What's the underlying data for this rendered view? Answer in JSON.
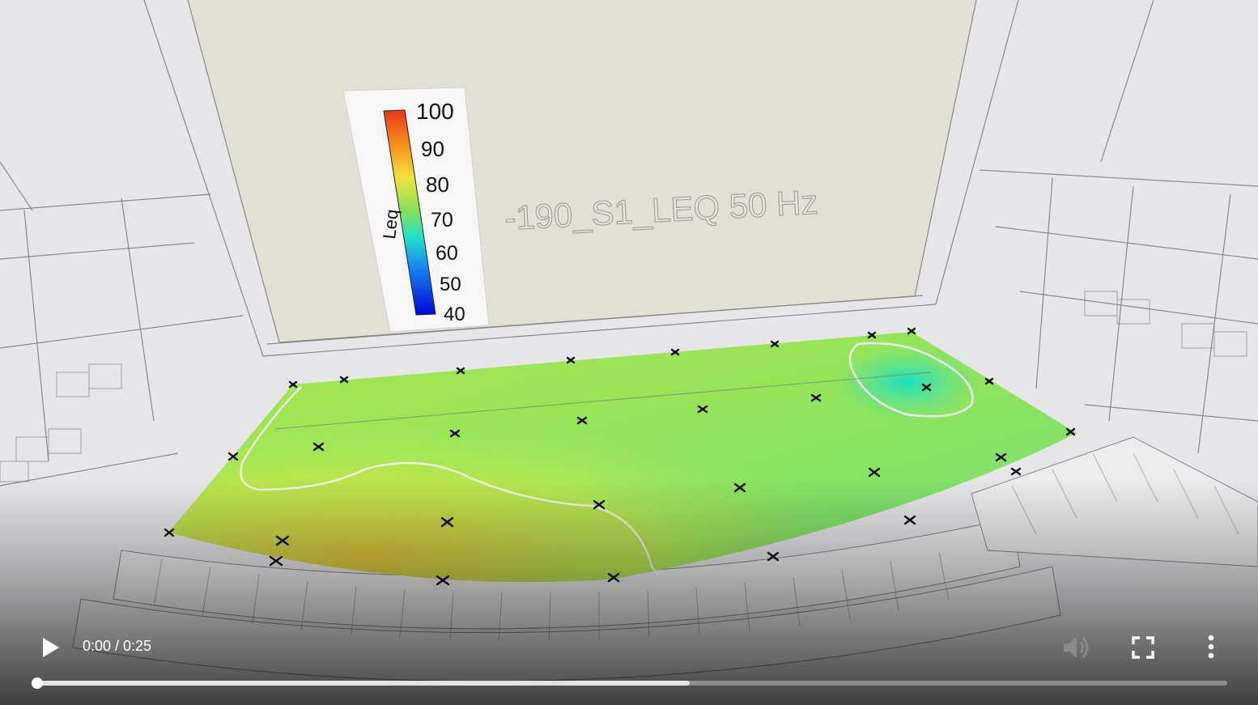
{
  "scene": {
    "title": "-190_S1_LEQ 50 Hz",
    "colorbar": {
      "quantity": "Leq",
      "ticks": [
        "100",
        "90",
        "80",
        "70",
        "60",
        "50",
        "40"
      ],
      "min": 40,
      "max": 100
    }
  },
  "player": {
    "current_time": "0:00",
    "separator": "/",
    "duration": "0:25",
    "time_display": "0:00 / 0:25",
    "progress_played": 0.0,
    "progress_buffered": 0.548,
    "state": "paused",
    "icons": {
      "play": "play-icon",
      "volume": "volume-icon",
      "fullscreen": "fullscreen-icon",
      "more": "more-options-icon"
    }
  }
}
